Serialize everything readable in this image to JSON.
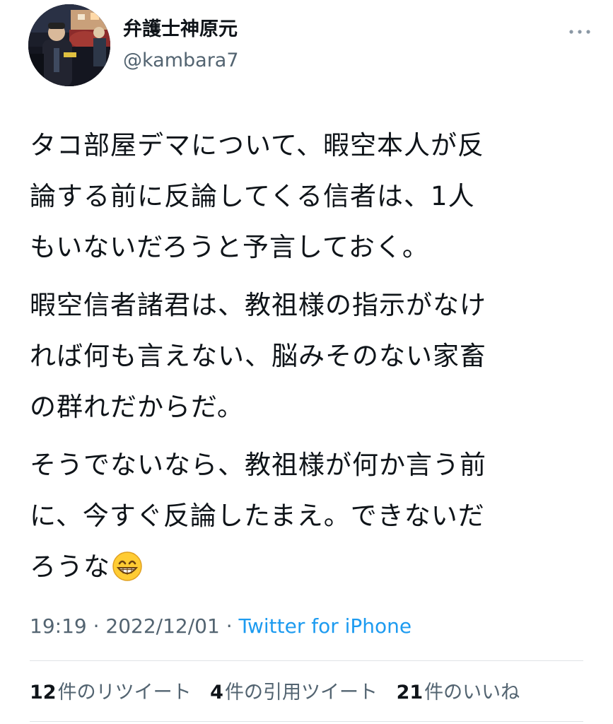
{
  "user": {
    "display_name": "弁護士神原元",
    "handle": "@kambara7"
  },
  "tweet": {
    "paragraphs": [
      [
        "タコ部屋デマについて、暇空本人が反",
        "論する前に反論してくる信者は、1人",
        "もいないだろうと予言しておく。"
      ],
      [
        "暇空信者諸君は、教祖様の指示がなけ",
        "れば何も言えない、脳みそのない家畜",
        "の群れだからだ。"
      ],
      [
        "そうでないなら、教祖様が何か言う前",
        "に、今すぐ反論したまえ。できないだ",
        "ろうな"
      ]
    ],
    "trailing_emoji": "grinning-face-with-smiling-eyes-icon"
  },
  "meta": {
    "time": "19:19",
    "separator": " · ",
    "date": "2022/12/01",
    "source": "Twitter for iPhone"
  },
  "stats": {
    "retweets_count": "12",
    "retweets_label": "件のリツイート",
    "quotes_count": "4",
    "quotes_label": "件の引用ツイート",
    "likes_count": "21",
    "likes_label": "件のいいね"
  },
  "colors": {
    "text": "#0f1419",
    "secondary": "#536471",
    "link": "#1d9bf0",
    "divider": "#dfe3e6"
  }
}
